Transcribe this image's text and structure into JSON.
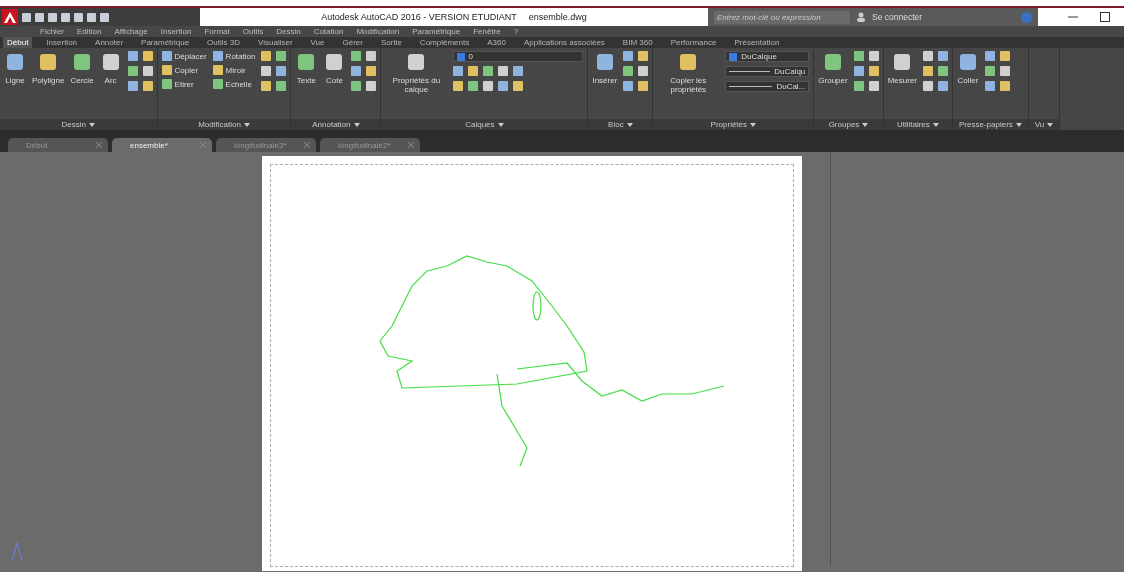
{
  "window": {
    "title": "Autodesk AutoCAD 2016 - VERSION ETUDIANT",
    "file": "ensemble.dwg"
  },
  "search": {
    "placeholder": "Entrez mot-clé ou expression"
  },
  "sign_in": "Se connecter",
  "menu": [
    "Fichier",
    "Edition",
    "Affichage",
    "Insertion",
    "Format",
    "Outils",
    "Dessin",
    "Cotation",
    "Modification",
    "Paramétrique",
    "Fenêtre",
    "?"
  ],
  "ribbon_tabs": [
    {
      "label": "Début",
      "selected": true
    },
    {
      "label": "Insertion",
      "selected": false
    },
    {
      "label": "Annoter",
      "selected": false
    },
    {
      "label": "Paramétrique",
      "selected": false
    },
    {
      "label": "Outils 3D",
      "selected": false
    },
    {
      "label": "Visualiser",
      "selected": false
    },
    {
      "label": "Vue",
      "selected": false
    },
    {
      "label": "Gérer",
      "selected": false
    },
    {
      "label": "Sortie",
      "selected": false
    },
    {
      "label": "Compléments",
      "selected": false
    },
    {
      "label": "A360",
      "selected": false
    },
    {
      "label": "Applications associées",
      "selected": false
    },
    {
      "label": "BIM 360",
      "selected": false
    },
    {
      "label": "Performance",
      "selected": false
    },
    {
      "label": "Présentation",
      "selected": false
    }
  ],
  "panels": [
    {
      "title": "Dessin",
      "tools": [
        {
          "kind": "large",
          "label": "Ligne"
        },
        {
          "kind": "large",
          "label": "Polyligne"
        },
        {
          "kind": "large",
          "label": "Cercle"
        },
        {
          "kind": "large",
          "label": "Arc"
        },
        {
          "kind": "icons"
        }
      ]
    },
    {
      "title": "Modification",
      "tools": [
        {
          "kind": "small",
          "label": "Déplacer"
        },
        {
          "kind": "small",
          "label": "Copier"
        },
        {
          "kind": "small",
          "label": "Etirer"
        },
        {
          "kind": "small",
          "label": "Rotation"
        },
        {
          "kind": "small",
          "label": "Miroir"
        },
        {
          "kind": "small",
          "label": "Echelle"
        },
        {
          "kind": "icons"
        }
      ]
    },
    {
      "title": "Annotation",
      "tools": [
        {
          "kind": "large",
          "label": "Texte"
        },
        {
          "kind": "large",
          "label": "Cote"
        },
        {
          "kind": "icons"
        }
      ]
    },
    {
      "title": "Calques",
      "tools": [
        {
          "kind": "large",
          "label": "Propriétés du calque"
        },
        {
          "kind": "layer",
          "label": "0"
        }
      ]
    },
    {
      "title": "Bloc",
      "tools": [
        {
          "kind": "large",
          "label": "Insérer"
        },
        {
          "kind": "icons"
        }
      ]
    },
    {
      "title": "Propriétés",
      "tools": [
        {
          "kind": "large",
          "label": "Copier les propriétés"
        },
        {
          "kind": "dropdowns",
          "values": [
            "DuCalque",
            "DuCalqu",
            "DuCal..."
          ]
        }
      ]
    },
    {
      "title": "Groupes",
      "tools": [
        {
          "kind": "large",
          "label": "Grouper"
        },
        {
          "kind": "icons"
        }
      ]
    },
    {
      "title": "Utilitaires",
      "tools": [
        {
          "kind": "large",
          "label": "Mesurer"
        },
        {
          "kind": "icons"
        }
      ]
    },
    {
      "title": "Presse-papiers",
      "tools": [
        {
          "kind": "large",
          "label": "Coller"
        },
        {
          "kind": "icons"
        }
      ]
    },
    {
      "title": "Vu"
    }
  ],
  "file_tabs": [
    {
      "label": "Début",
      "selected": false
    },
    {
      "label": "ensemble*",
      "selected": true
    },
    {
      "label": "longitudinale3*",
      "selected": false
    },
    {
      "label": "longitudinale2*",
      "selected": false
    }
  ]
}
